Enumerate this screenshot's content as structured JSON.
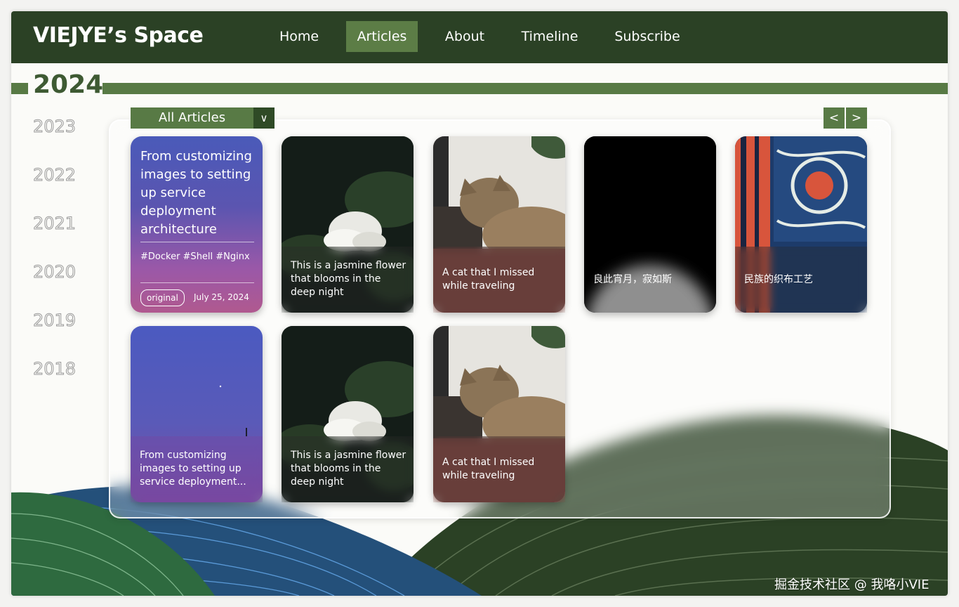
{
  "header": {
    "brand": "VIEJYE’s Space",
    "nav": [
      "Home",
      "Articles",
      "About",
      "Timeline",
      "Subscribe"
    ],
    "active_nav": "Articles"
  },
  "timeline": {
    "current_year": "2024",
    "years": [
      "2023",
      "2022",
      "2021",
      "2020",
      "2019",
      "2018"
    ]
  },
  "filter": {
    "label": "All Articles",
    "caret": "∨"
  },
  "pager": {
    "prev": "<",
    "next": ">"
  },
  "featured": {
    "title": "From customizing images to setting up service deployment architecture",
    "tags": "#Docker #Shell #Nginx",
    "badge": "original",
    "date": "July 25, 2024"
  },
  "cards": [
    {
      "caption": "This is a jasmine flower that blooms in the deep night",
      "image": "jasmine-flower"
    },
    {
      "caption": "A cat that I missed while traveling",
      "image": "cat"
    },
    {
      "caption": "良此宵月，寂如斯",
      "image": "moon"
    },
    {
      "caption": "民族的织布工艺",
      "image": "woven-fabric"
    },
    {
      "caption": "From customizing images to setting up service deployment...",
      "image": "purple-sky"
    },
    {
      "caption": "This is a jasmine flower that blooms in the deep night",
      "image": "jasmine-flower"
    },
    {
      "caption": "A cat that I missed while traveling",
      "image": "cat"
    }
  ],
  "watermark": "掘金技术社区 @ 我咯小VIE",
  "colors": {
    "header": "#2b4125",
    "accent": "#587a45",
    "active": "#5c7d46",
    "hill_dark": "#2b4125",
    "hill_blue": "#24507a",
    "hill_green": "#2e6a3f"
  }
}
